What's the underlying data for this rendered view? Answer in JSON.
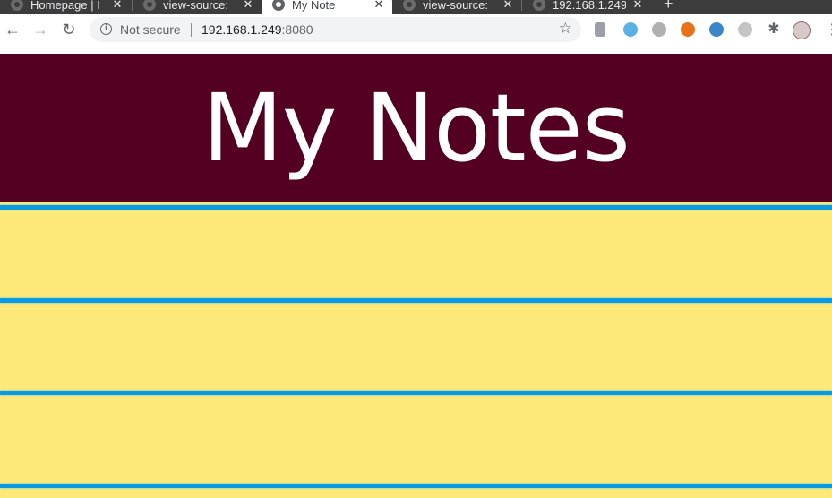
{
  "browser": {
    "tabs": [
      {
        "title": "Homepage | I",
        "active": false
      },
      {
        "title": "view-source:",
        "active": false
      },
      {
        "title": "My Note",
        "active": true
      },
      {
        "title": "view-source:",
        "active": false
      },
      {
        "title": "192.168.1.249",
        "active": false
      }
    ],
    "close_glyph": "✕",
    "new_tab_glyph": "+",
    "nav": {
      "back_glyph": "←",
      "forward_glyph": "→",
      "reload_glyph": "↻"
    },
    "omnibox": {
      "security_label": "Not secure",
      "info_glyph": "i",
      "url_host": "192.168.1.249",
      "url_port": ":8080",
      "star_glyph": "☆"
    },
    "extensions": [
      {
        "name": "grey-extension-icon",
        "color": "#9aa0a6"
      },
      {
        "name": "circle-extension-icon",
        "color": "#5bb0e6"
      },
      {
        "name": "moon-extension-icon",
        "color": "#b0b0b0"
      },
      {
        "name": "orange-extension-icon",
        "color": "#e8711a"
      },
      {
        "name": "blue-extension-icon",
        "color": "#3a86c8"
      },
      {
        "name": "link-extension-icon",
        "color": "#c4c4c4"
      }
    ],
    "puzzle_glyph": "✱",
    "menu_glyph": "⋮"
  },
  "page": {
    "title": "My Notes",
    "colors": {
      "header_bg": "#540022",
      "paper_bg": "#fde97a",
      "rule_line": "#0a9ae0"
    },
    "lines_visible": 4
  }
}
